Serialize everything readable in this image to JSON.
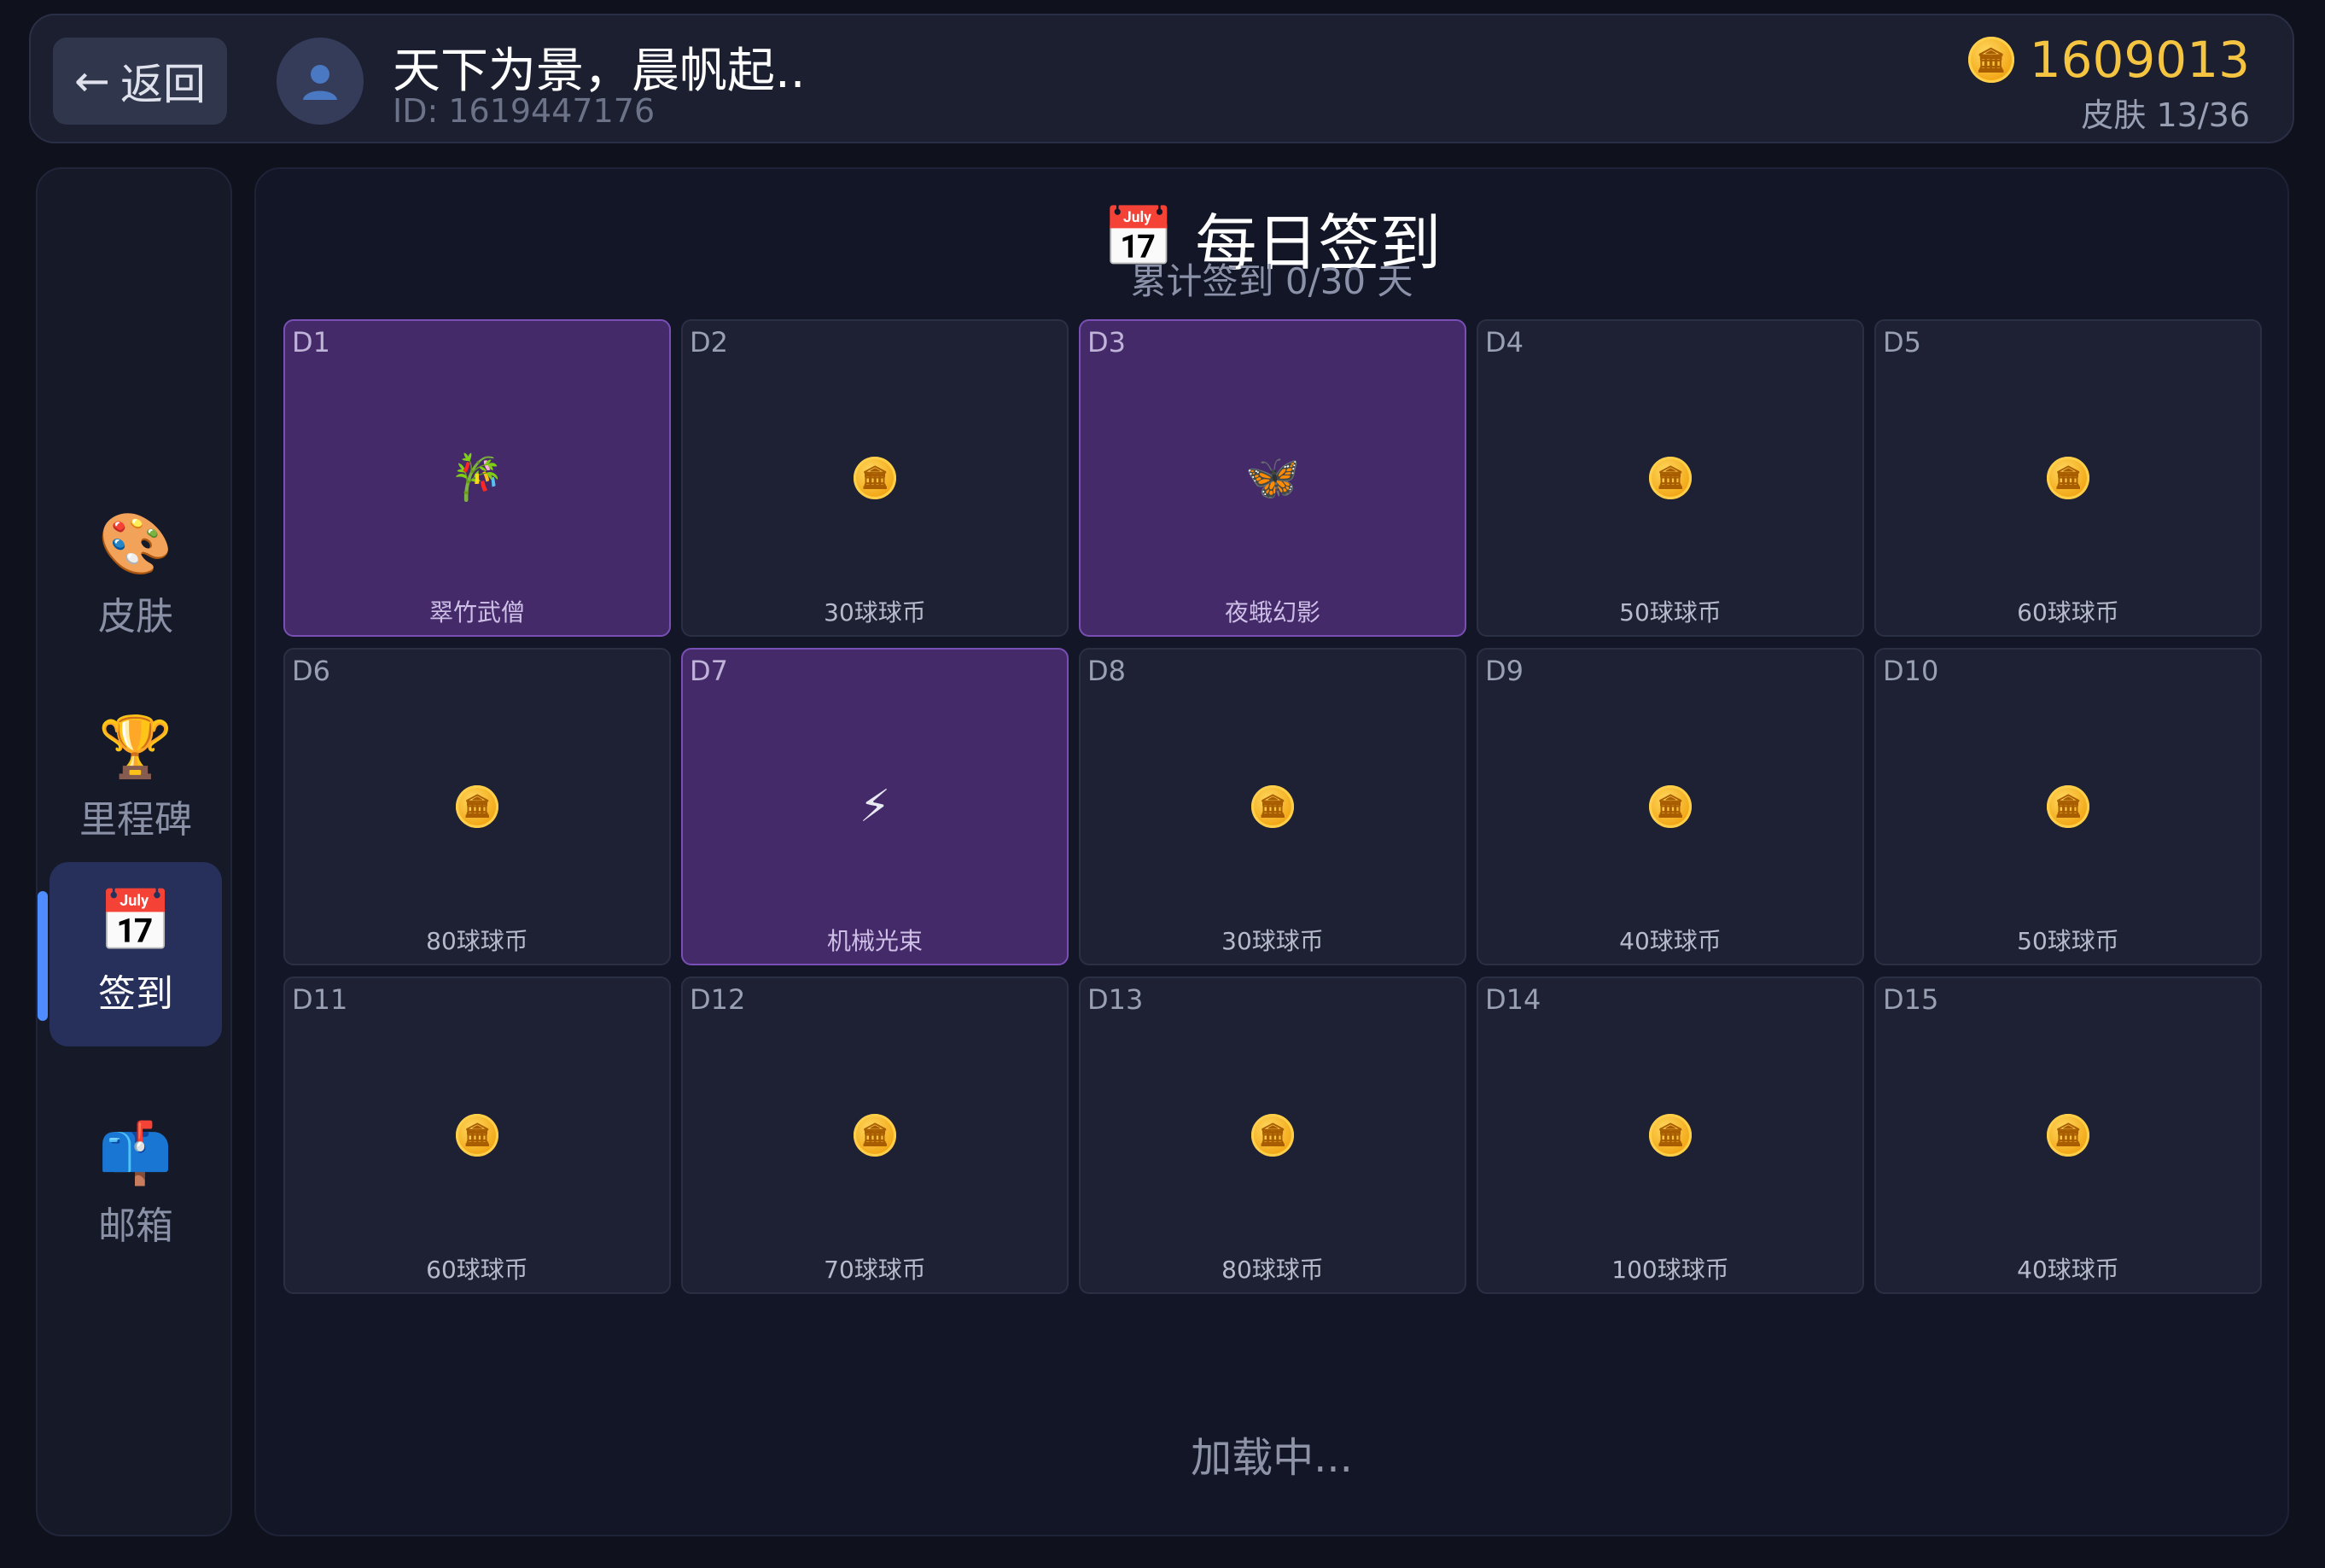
{
  "header": {
    "back_label": "返回",
    "nickname": "天下为景，晨帆起..",
    "user_id": "ID: 1619447176",
    "coins": "1609013",
    "skins": "皮肤 13/36"
  },
  "sidebar": {
    "items": [
      {
        "label": "皮肤",
        "icon": "palette-icon",
        "glyph": "🎨"
      },
      {
        "label": "里程碑",
        "icon": "trophy-icon",
        "glyph": "🏆"
      },
      {
        "label": "签到",
        "icon": "calendar-icon",
        "glyph": "📅"
      },
      {
        "label": "邮箱",
        "icon": "mailbox-icon",
        "glyph": "📫"
      }
    ]
  },
  "checkin": {
    "title": "每日签到",
    "subtitle": "累计签到 0/30 天",
    "days": [
      {
        "day": "D1",
        "reward": "翠竹武僧",
        "type": "skin",
        "icon": "🎋"
      },
      {
        "day": "D2",
        "reward": "30球球币",
        "type": "coin"
      },
      {
        "day": "D3",
        "reward": "夜蛾幻影",
        "type": "skin",
        "icon": "🦋"
      },
      {
        "day": "D4",
        "reward": "50球球币",
        "type": "coin"
      },
      {
        "day": "D5",
        "reward": "60球球币",
        "type": "coin"
      },
      {
        "day": "D6",
        "reward": "80球球币",
        "type": "coin"
      },
      {
        "day": "D7",
        "reward": "机械光束",
        "type": "skin",
        "icon": "⚡"
      },
      {
        "day": "D8",
        "reward": "30球球币",
        "type": "coin"
      },
      {
        "day": "D9",
        "reward": "40球球币",
        "type": "coin"
      },
      {
        "day": "D10",
        "reward": "50球球币",
        "type": "coin"
      },
      {
        "day": "D11",
        "reward": "60球球币",
        "type": "coin"
      },
      {
        "day": "D12",
        "reward": "70球球币",
        "type": "coin"
      },
      {
        "day": "D13",
        "reward": "80球球币",
        "type": "coin"
      },
      {
        "day": "D14",
        "reward": "100球球币",
        "type": "coin"
      },
      {
        "day": "D15",
        "reward": "40球球币",
        "type": "coin"
      }
    ],
    "loading": "加载中..."
  },
  "colors": {
    "accent": "#4f8cff",
    "coin": "#f5c542",
    "skin_card": "#452a6a",
    "background": "#0f121c"
  }
}
